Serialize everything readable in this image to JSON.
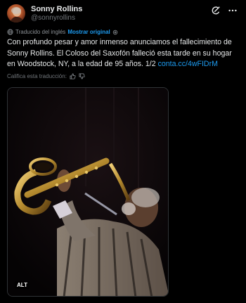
{
  "author": {
    "display_name": "Sonny Rollins",
    "handle": "@sonnyrollins",
    "avatar_icon": "avatar-photo"
  },
  "header_icons": [
    "grok-icon",
    "more-icon"
  ],
  "translation": {
    "label": "Traducido del inglés",
    "show_original": "Mostrar original"
  },
  "post": {
    "text": "Con profundo pesar y amor inmenso anunciamos el fallecimiento de Sonny Rollins. El Coloso del Saxofón falleció esta tarde en su hogar en Woodstock, NY, a la edad de 95 años. 1/2 ",
    "link": "conta.cc/4wFIDrM"
  },
  "rate": {
    "label": "Califica esta traducción:"
  },
  "media": {
    "alt_badge": "ALT"
  },
  "colors": {
    "background": "#000000",
    "text": "#e7e9ea",
    "muted": "#71767b",
    "link": "#1d9bf0"
  }
}
